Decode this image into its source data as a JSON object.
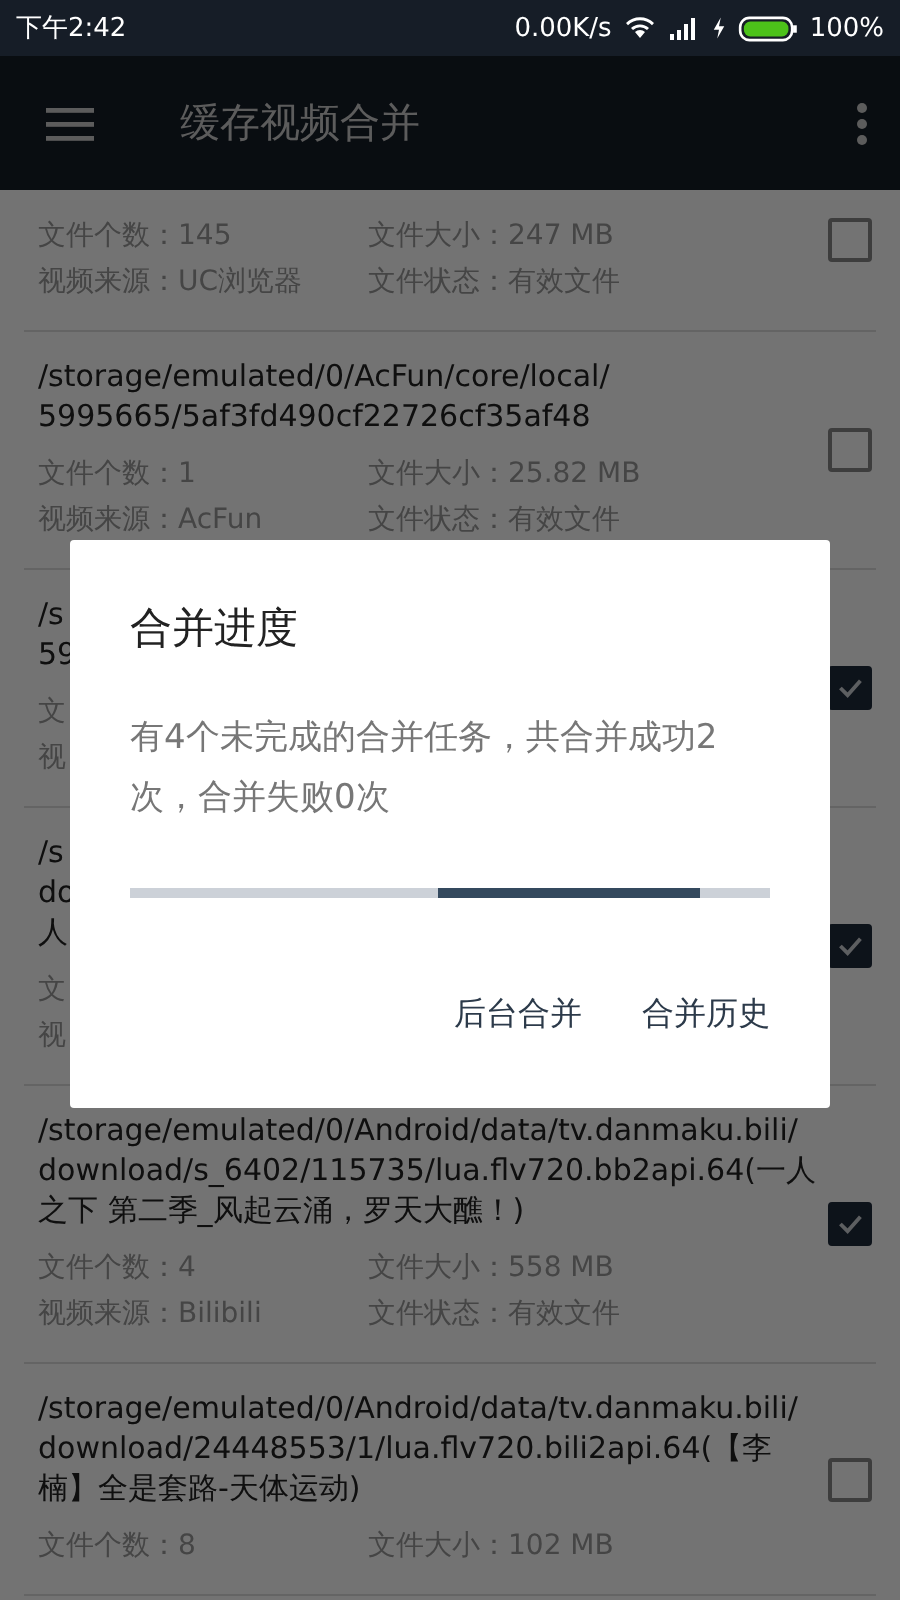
{
  "status_bar": {
    "time": "下午2:42",
    "net_speed": "0.00K/s",
    "battery": "100%"
  },
  "toolbar": {
    "title": "缓存视频合并"
  },
  "items": [
    {
      "info_rows": [
        [
          "文件个数：145",
          "文件大小：247 MB"
        ],
        [
          "视频来源：UC浏览器",
          "文件状态：有效文件"
        ]
      ],
      "checked": false
    },
    {
      "path_lines": [
        "/storage/emulated/0/AcFun/core/local/",
        "5995665/5af3fd490cf22726cf35af48"
      ],
      "info_rows": [
        [
          "文件个数：1",
          "文件大小：25.82 MB"
        ],
        [
          "视频来源：AcFun",
          "文件状态：有效文件"
        ]
      ],
      "checked": false
    },
    {
      "path_lines": [
        "/s",
        "59"
      ],
      "info_rows": [
        [
          "文"
        ],
        [
          "视"
        ]
      ],
      "checked": true
    },
    {
      "path_lines": [
        "/s",
        "do",
        "人"
      ],
      "info_rows": [
        [
          "文"
        ],
        [
          "视"
        ]
      ],
      "checked": true
    },
    {
      "path_lines": [
        "/storage/emulated/0/Android/data/tv.danmaku.bili/",
        "download/s_6402/115735/lua.flv720.bb2api.64(一人",
        "之下 第二季_风起云涌，罗天大醮！)"
      ],
      "info_rows": [
        [
          "文件个数：4",
          "文件大小：558 MB"
        ],
        [
          "视频来源：Bilibili",
          "文件状态：有效文件"
        ]
      ],
      "checked": true
    },
    {
      "path_lines": [
        "/storage/emulated/0/Android/data/tv.danmaku.bili/",
        "download/24448553/1/lua.flv720.bili2api.64(【李",
        "楠】全是套路-天体运动)"
      ],
      "info_rows": [
        [
          "文件个数：8",
          "文件大小：102 MB"
        ]
      ],
      "checked": false
    }
  ],
  "dialog": {
    "title": "合并进度",
    "message": "有4个未完成的合并任务，共合并成功2次，合并失败0次",
    "progress": {
      "indeterminate": true
    },
    "buttons": [
      "后台合并",
      "合并历史"
    ]
  }
}
